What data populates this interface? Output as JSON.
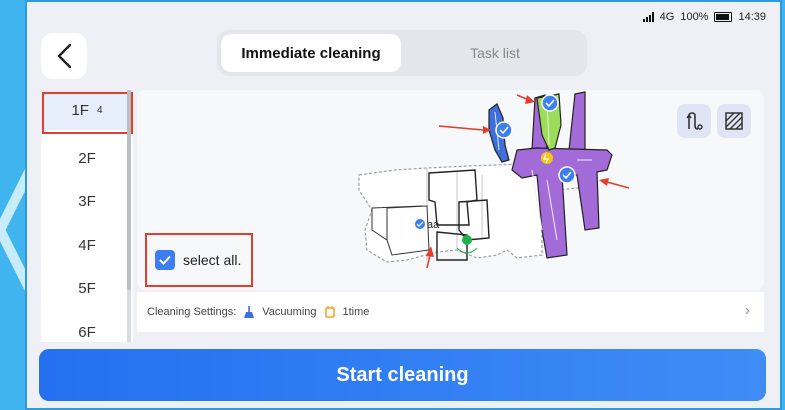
{
  "status": {
    "network": "4G",
    "battery": "100%",
    "time": "14:39"
  },
  "tabs": [
    {
      "label": "Immediate cleaning"
    },
    {
      "label": "Task list"
    }
  ],
  "floors": [
    {
      "label": "1F",
      "count": "4"
    },
    {
      "label": "2F"
    },
    {
      "label": "3F"
    },
    {
      "label": "4F"
    },
    {
      "label": "5F"
    },
    {
      "label": "6F"
    }
  ],
  "map": {
    "room_label": "aa",
    "room_colors": {
      "blue": "#3f6fdb",
      "green": "#9bdc5a",
      "purple": "#a36bd8"
    },
    "annotation_color": "#e23e2b"
  },
  "select_all": {
    "label": "select all."
  },
  "settings": {
    "prefix": "Cleaning Settings:",
    "mode": "Vacuuming",
    "times": "1time"
  },
  "actions": {
    "start": "Start cleaning"
  },
  "colors": {
    "accent": "#3d7ef0",
    "frame": "#2a9be0",
    "background": "#3fb4ee"
  }
}
